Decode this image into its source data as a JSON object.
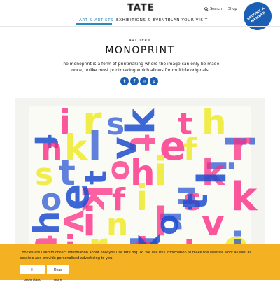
{
  "header": {
    "logo": "TATE",
    "search_label": "Search",
    "shop_label": "Shop",
    "member_badge": "BECOME A MEMBER"
  },
  "nav": {
    "items": [
      {
        "label": "ART & ARTISTS",
        "active": true
      },
      {
        "label": "EXHIBITIONS & EVENTS",
        "active": false
      },
      {
        "label": "PLAN YOUR VISIT",
        "active": false
      }
    ]
  },
  "article": {
    "eyebrow": "ART TERM",
    "title": "MONOPRINT",
    "description": "The monoprint is a form of printmaking where the image can only be made once, unlike most printmaking which allows for multiple originals"
  },
  "share": {
    "icons": [
      "twitter-icon",
      "facebook-icon",
      "email-icon",
      "pinterest-icon"
    ],
    "glyphs": [
      "t",
      "f",
      "✉",
      "p"
    ]
  },
  "artwork": {
    "letters": [
      "f",
      "i",
      "r",
      "s",
      "t",
      "k",
      "t",
      "h",
      "i",
      "n",
      "k",
      "l",
      "o",
      "v",
      "e"
    ]
  },
  "cookie_banner": {
    "text": "Cookies are used to collect information about how you use tate.org.uk. We use this information to make the website work as well as possible and provide personalised advertising to you.",
    "accept_label": "I understand",
    "read_more_label": "Read more",
    "background": "#f4b223"
  },
  "colors": {
    "accent": "#2a8bb6",
    "brand_blue": "#1a5fb4"
  }
}
